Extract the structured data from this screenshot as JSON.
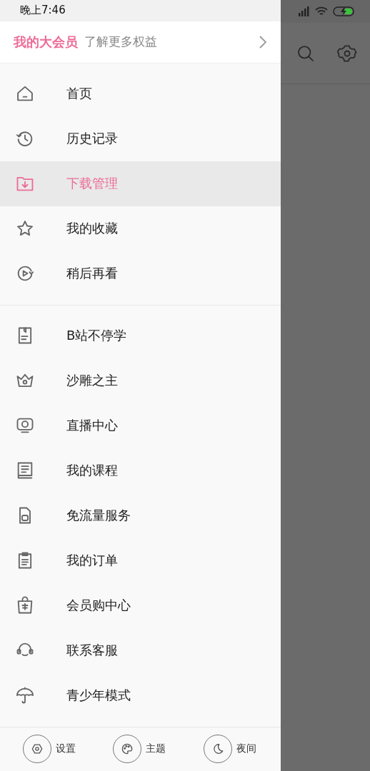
{
  "status_bar": {
    "time": "晚上7:46"
  },
  "vip_banner": {
    "title": "我的大会员",
    "subtitle": "了解更多权益"
  },
  "menu_groups": [
    [
      {
        "label": "首页",
        "selected": false
      },
      {
        "label": "历史记录",
        "selected": false
      },
      {
        "label": "下载管理",
        "selected": true
      },
      {
        "label": "我的收藏",
        "selected": false
      },
      {
        "label": "稍后再看",
        "selected": false
      }
    ],
    [
      {
        "label": "B站不停学",
        "selected": false
      },
      {
        "label": "沙雕之主",
        "selected": false
      },
      {
        "label": "直播中心",
        "selected": false
      },
      {
        "label": "我的课程",
        "selected": false
      },
      {
        "label": "免流量服务",
        "selected": false
      },
      {
        "label": "我的订单",
        "selected": false
      },
      {
        "label": "会员购中心",
        "selected": false
      },
      {
        "label": "联系客服",
        "selected": false
      },
      {
        "label": "青少年模式",
        "selected": false
      }
    ]
  ],
  "footer_buttons": [
    {
      "label": "设置"
    },
    {
      "label": "主题"
    },
    {
      "label": "夜间"
    }
  ]
}
